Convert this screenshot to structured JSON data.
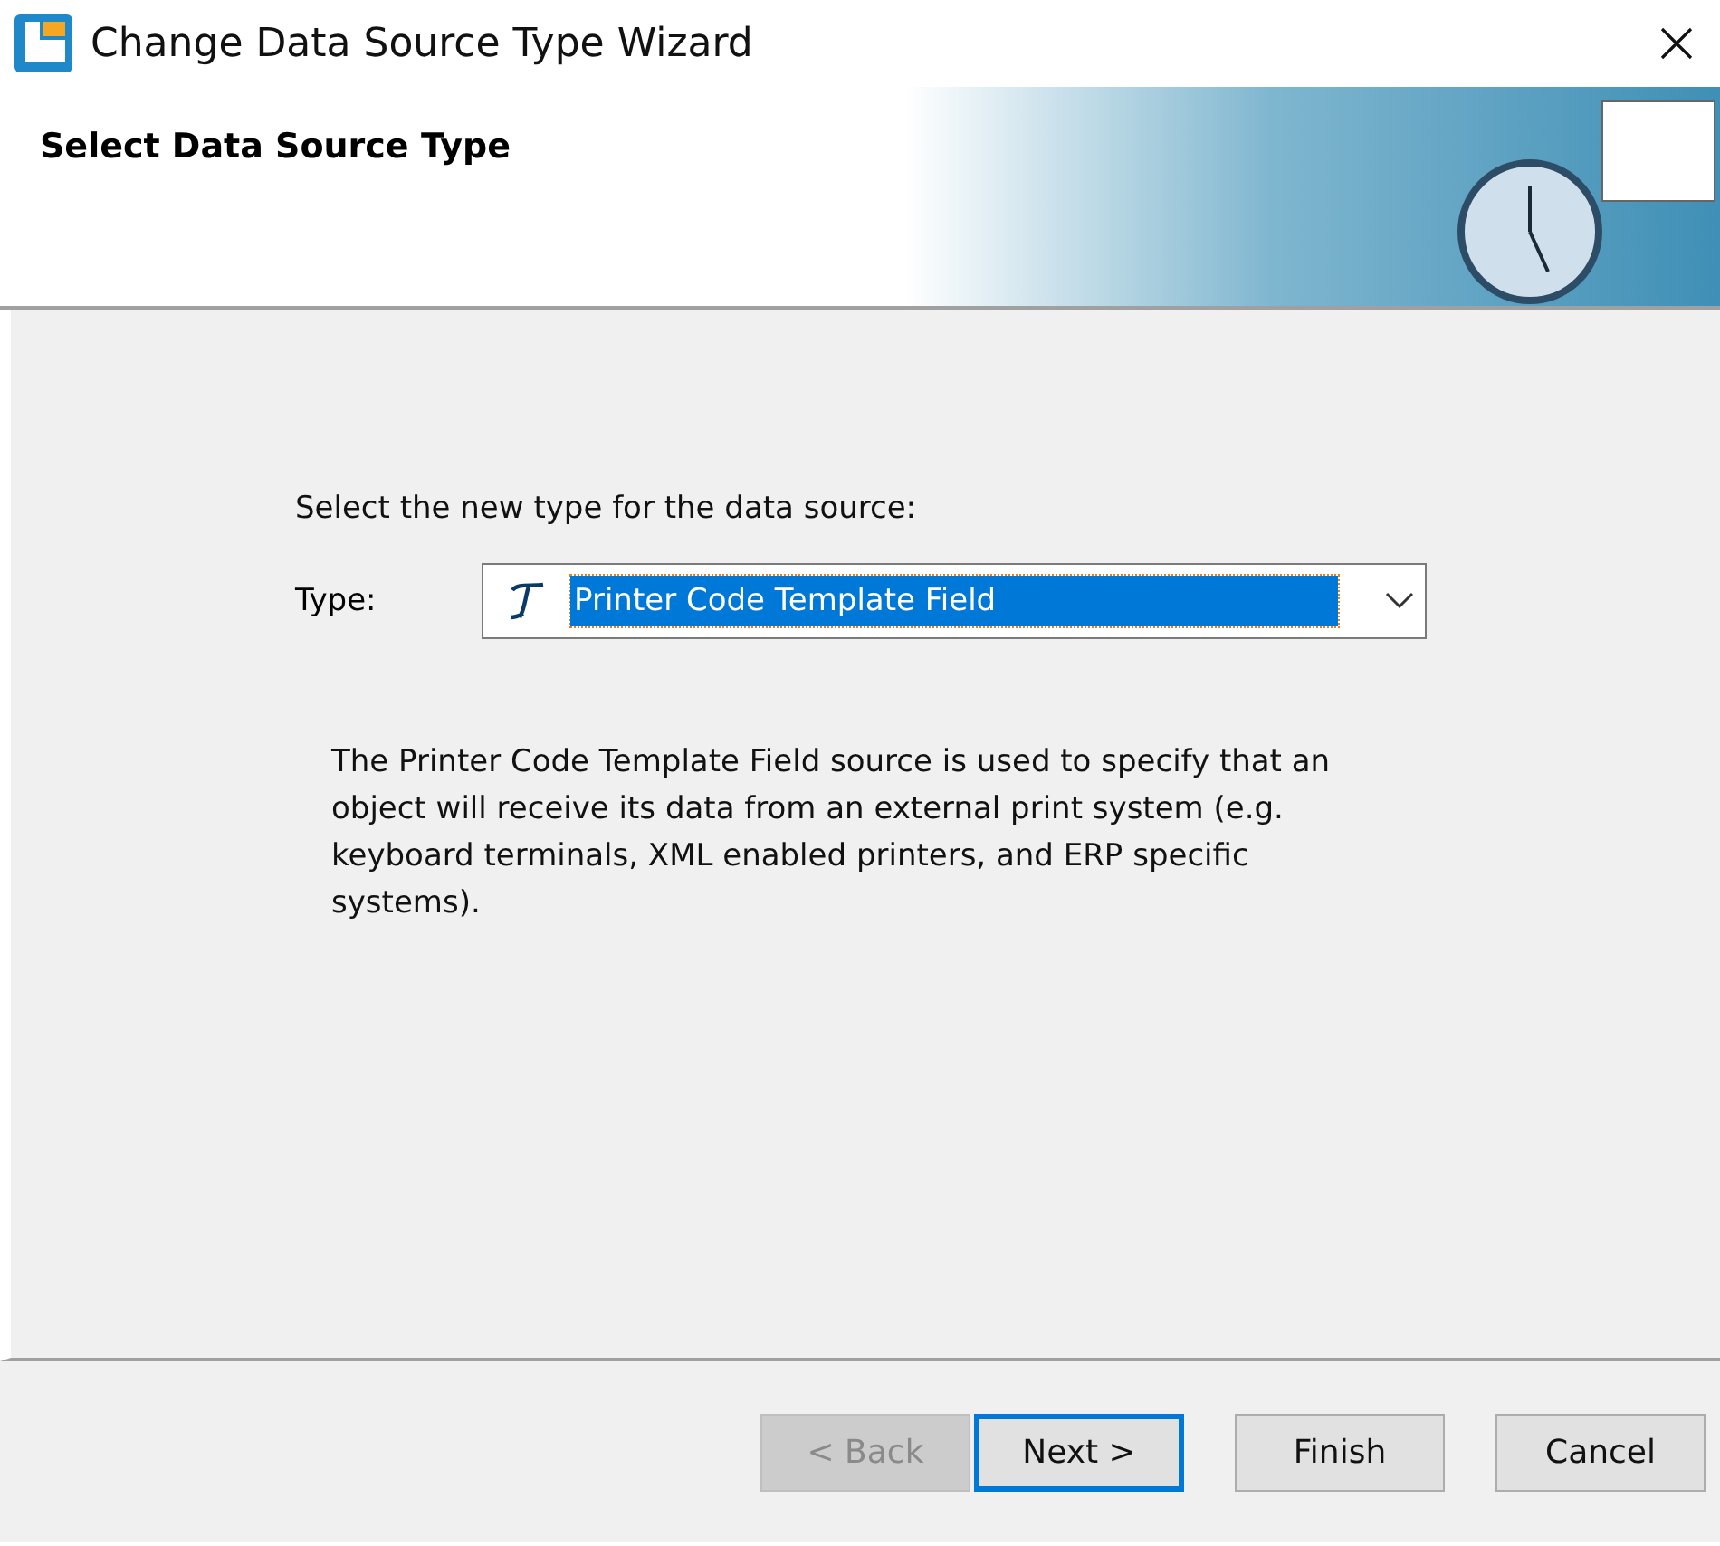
{
  "window": {
    "title": "Change Data Source Type Wizard"
  },
  "header": {
    "title": "Select Data Source Type"
  },
  "body": {
    "prompt": "Select the new type for the data source:",
    "type_label": "Type:",
    "type_value": "Printer Code Template Field",
    "description": "The Printer Code Template Field source is used to specify that an object will receive its data from an external print system (e.g. keyboard terminals, XML enabled printers, and ERP specific systems)."
  },
  "buttons": [
    {
      "label": "< Back",
      "disabled": true,
      "default": false
    },
    {
      "label": "Next >",
      "disabled": false,
      "default": true
    },
    {
      "label": "Finish",
      "disabled": false,
      "default": false
    },
    {
      "label": "Cancel",
      "disabled": false,
      "default": false
    }
  ]
}
